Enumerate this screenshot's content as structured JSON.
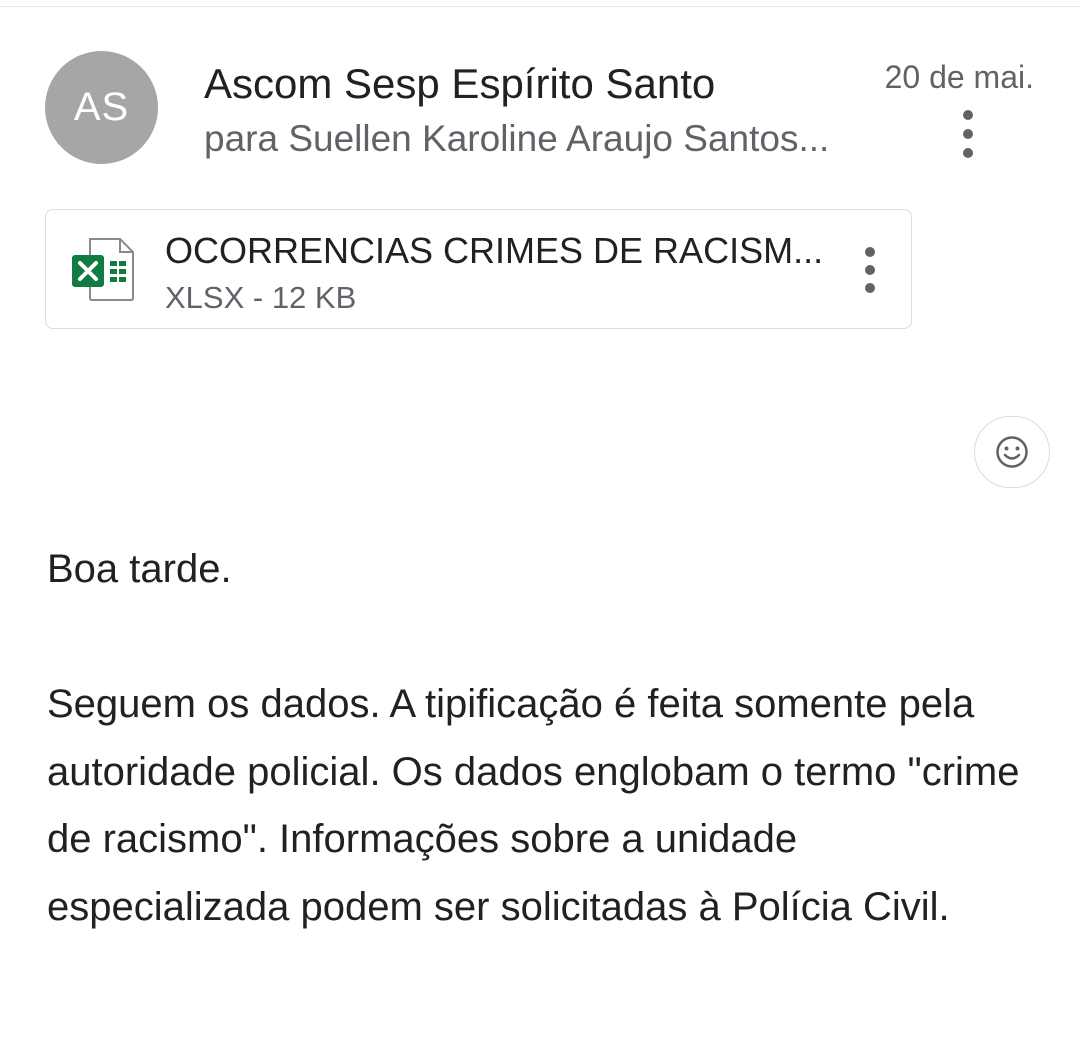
{
  "email": {
    "sender_initials": "AS",
    "sender_name": "Ascom Sesp Espírito Santo",
    "recipient": "para Suellen Karoline Araujo Santos...",
    "date": "20 de mai."
  },
  "attachment": {
    "name": "OCORRENCIAS CRIMES DE RACISM...",
    "meta": "XLSX - 12 KB",
    "icon": "excel-file-icon",
    "icon_color": "#107c41"
  },
  "body": {
    "greeting": "Boa tarde.",
    "message": "Seguem os dados. A tipificação é feita somente pela autoridade policial. Os dados englobam o termo \"crime de racismo\". Informações sobre a unidade especializada podem ser solicitadas à Polícia Civil."
  },
  "icons": {
    "more_options": "more-vert-icon",
    "reaction": "add-reaction-icon"
  }
}
